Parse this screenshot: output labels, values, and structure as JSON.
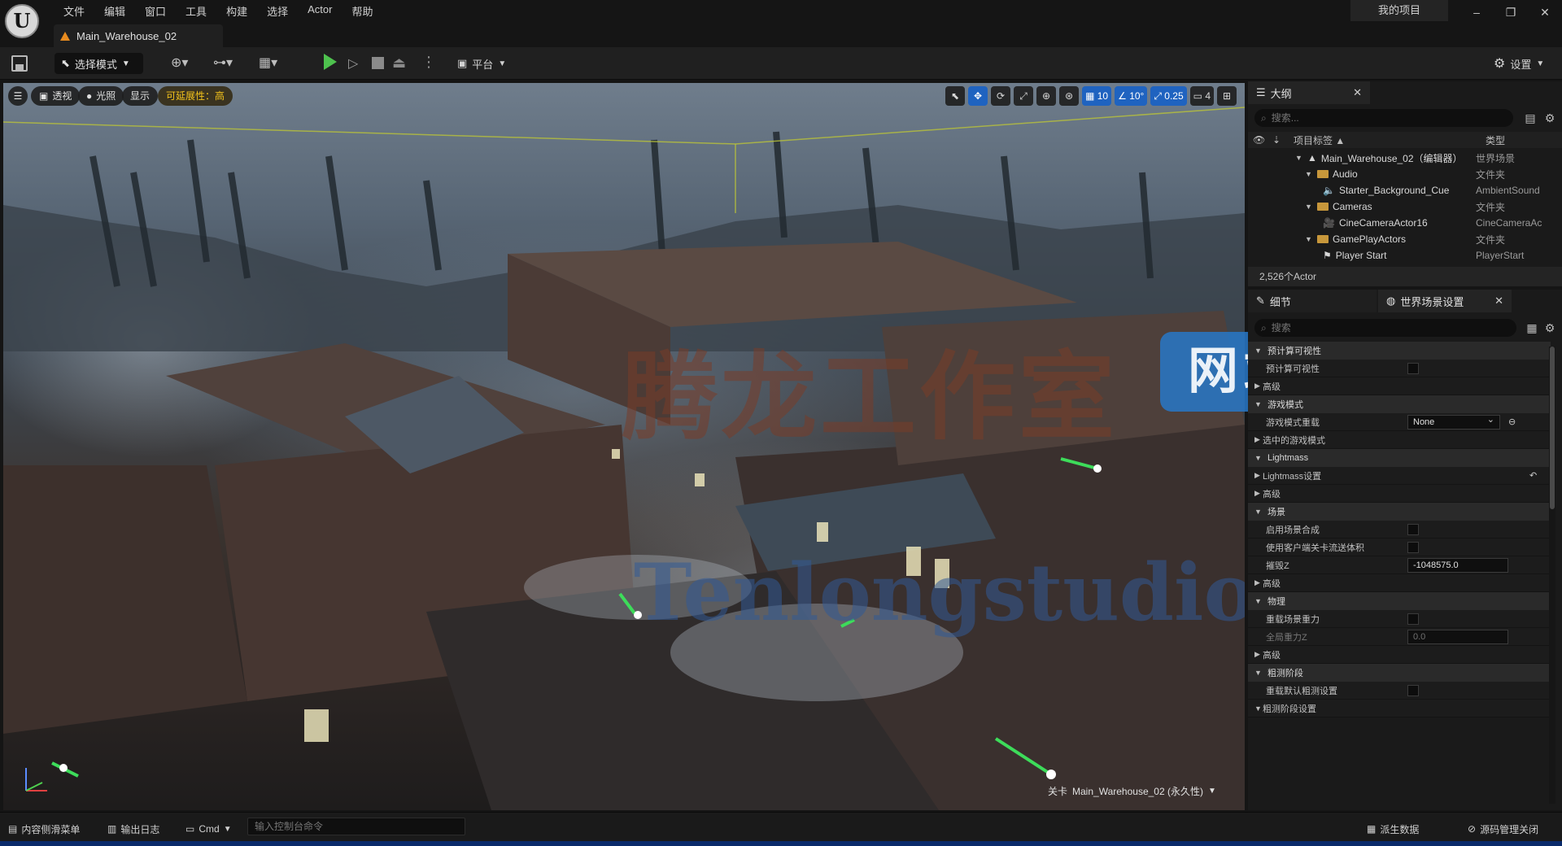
{
  "menu": [
    "文件",
    "编辑",
    "窗口",
    "工具",
    "构建",
    "选择",
    "Actor",
    "帮助"
  ],
  "project_name": "我的项目",
  "window": {
    "minimize": "–",
    "restore": "❐",
    "close": "✕"
  },
  "doc_tab": "Main_Warehouse_02",
  "toolbar": {
    "mode": "选择模式",
    "platform": "平台",
    "settings": "设置"
  },
  "viewport": {
    "perspective": "透视",
    "lit": "光照",
    "show": "显示",
    "scalability": "可延展性：高",
    "grid_snap": "10",
    "rotate_snap": "10°",
    "scale_snap": "0.25",
    "camera_speed": "4",
    "level_label": "关卡",
    "level_name": "Main_Warehouse_02 (永久性)",
    "watermark_cn": "腾龙工作室",
    "watermark_url": "Tenlongstudio.com",
    "watermark_badge": "网站"
  },
  "outliner": {
    "title": "大纲",
    "search_placeholder": "搜索...",
    "col_label": "项目标签",
    "col_type": "类型",
    "rows": [
      {
        "name": "Main_Warehouse_02（编辑器）",
        "type": "世界场景"
      },
      {
        "name": "Audio",
        "type": "文件夹"
      },
      {
        "name": "Starter_Background_Cue",
        "type": "AmbientSound"
      },
      {
        "name": "Cameras",
        "type": "文件夹"
      },
      {
        "name": "CineCameraActor16",
        "type": "CineCameraAc"
      },
      {
        "name": "GamePlayActors",
        "type": "文件夹"
      },
      {
        "name": "Player Start",
        "type": "PlayerStart"
      }
    ],
    "actor_count": "2,526个Actor"
  },
  "details": {
    "tab_details": "细节",
    "tab_world": "世界场景设置",
    "search_placeholder": "搜索",
    "sections": {
      "precomputed": "预计算可视性",
      "precomputed_row": "预计算可视性",
      "advanced1": "高级",
      "gamemode": "游戏模式",
      "gamemode_override": "游戏模式重载",
      "gamemode_value": "None",
      "selected_gamemode": "选中的游戏模式",
      "lightmass": "Lightmass",
      "lightmass_settings": "Lightmass设置",
      "advanced2": "高级",
      "world": "场景",
      "world_comp": "启用场景合成",
      "client_stream": "使用客户端关卡流送体积",
      "killz": "摧毁Z",
      "killz_value": "-1048575.0",
      "advanced3": "高级",
      "physics": "物理",
      "override_gravity": "重载场景重力",
      "global_gravity": "全局重力Z",
      "global_gravity_value": "0.0",
      "advanced4": "高级",
      "broadphase": "粗测阶段",
      "override_broadphase": "重载默认粗测设置",
      "broadphase_settings": "粗测阶段设置"
    }
  },
  "bottombar": {
    "content_drawer": "内容侧滑菜单",
    "output_log": "输出日志",
    "cmd": "Cmd",
    "console_placeholder": "输入控制台命令",
    "derived_data": "派生数据",
    "source_control": "源码管理关闭"
  }
}
